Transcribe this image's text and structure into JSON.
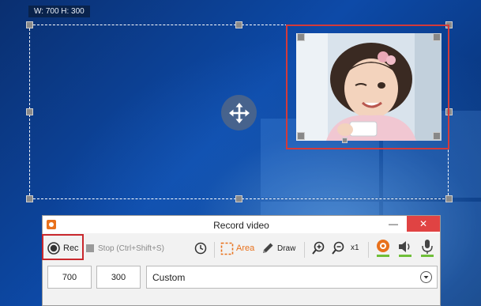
{
  "selection": {
    "dimensions_label": "W: 700 H: 300"
  },
  "recorder": {
    "title": "Record video",
    "window_buttons": {
      "minimize": "—",
      "close": "✕"
    },
    "toolbar": {
      "rec_label": "Rec",
      "stop_label": "Stop (Ctrl+Shift+S)",
      "area_label": "Area",
      "draw_label": "Draw",
      "zoom_level": "x1"
    },
    "width_value": "700",
    "height_value": "300",
    "preset_value": "Custom"
  },
  "colors": {
    "accent_orange": "#e8711c",
    "highlight_red": "#c9282d",
    "webcam_green": "#6fbf3a"
  }
}
